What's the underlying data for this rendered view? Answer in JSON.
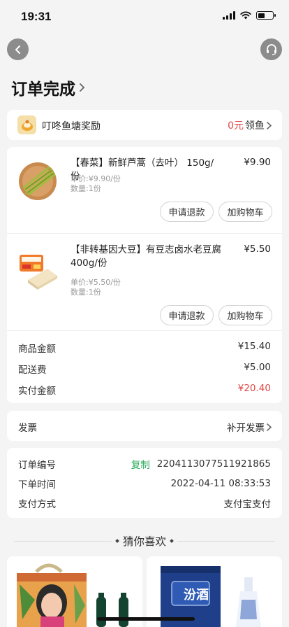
{
  "status_bar": {
    "time": "19:31",
    "battery_level": 0.45
  },
  "page": {
    "title": "订单完成"
  },
  "reward": {
    "label": "叮咚鱼塘奖励",
    "amount": "0元",
    "action": "领鱼"
  },
  "products": [
    {
      "name": "【春菜】新鲜芦蒿（去叶） 150g/份",
      "price": "¥9.90",
      "unit_price": "单价:¥9.90/份",
      "quantity": "数量:1份",
      "refund_label": "申请退款",
      "cart_label": "加购物车"
    },
    {
      "name": "【非转基因大豆】有豆志卤水老豆腐 400g/份",
      "price": "¥5.50",
      "unit_price": "单价:¥5.50/份",
      "quantity": "数量:1份",
      "refund_label": "申请退款",
      "cart_label": "加购物车"
    }
  ],
  "summary": {
    "goods_label": "商品金额",
    "goods_value": "¥15.40",
    "delivery_label": "配送费",
    "delivery_value": "¥5.00",
    "paid_label": "实付金额",
    "paid_value": "¥20.40"
  },
  "invoice": {
    "label": "发票",
    "action": "补开发票"
  },
  "order_info": {
    "number_label": "订单编号",
    "copy_label": "复制",
    "number_value": "2204113077511921865",
    "time_label": "下单时间",
    "time_value": "2022-04-11 08:33:53",
    "pay_label": "支付方式",
    "pay_value": "支付宝支付"
  },
  "recommend": {
    "title": "猜你喜欢",
    "product_2_text": "汾酒"
  },
  "colors": {
    "accent_red": "#e24848",
    "copy_green": "#2ba95b",
    "background": "#f4f4f4"
  }
}
